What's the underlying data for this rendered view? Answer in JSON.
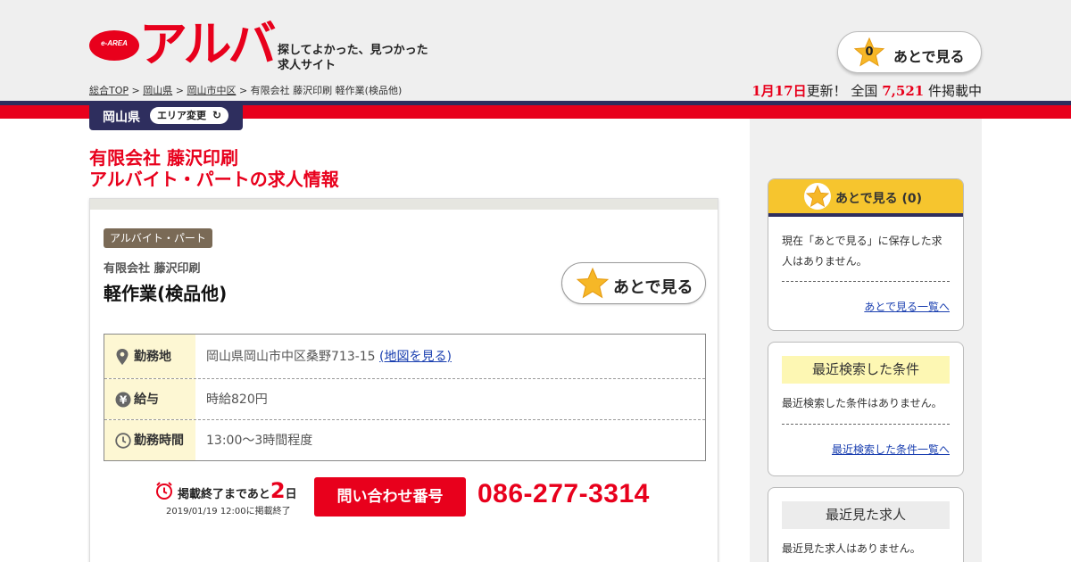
{
  "brand": {
    "logo_badge": "e-AREA",
    "logo_text": "アルバ",
    "tagline_line1": "探してよかった、見つかった",
    "tagline_line2": "求人サイト",
    "primary_color": "#e8001c",
    "navy_color": "#2e2e5e"
  },
  "breadcrumb": {
    "items": [
      "総合TOP",
      "岡山県",
      "岡山市中区"
    ],
    "separator": ">",
    "current": "有限会社 藤沢印刷 軽作業(検品他)"
  },
  "header": {
    "later_label": "あとで見る",
    "later_count": "0",
    "update_date": "1月17日",
    "update_suffix": "更新！",
    "nationwide_label": "全国",
    "total_count": "7,521",
    "count_suffix": "件掲載中"
  },
  "region": {
    "prefecture": "岡山県",
    "change_label": "エリア変更",
    "refresh_icon": "refresh-icon"
  },
  "page": {
    "title_line1": "有限会社 藤沢印刷",
    "title_line2": "アルバイト・パートの求人情報"
  },
  "job": {
    "type_badge": "アルバイト・パート",
    "company": "有限会社 藤沢印刷",
    "title": "軽作業(検品他)",
    "later_label": "あとで見る",
    "details": {
      "location_label": "勤務地",
      "location_value": "岡山県岡山市中区桑野713-15",
      "map_link": "(地図を見る)",
      "salary_label": "給与",
      "salary_value": "時給820円",
      "hours_label": "勤務時間",
      "hours_value": "13:00〜3時間程度"
    },
    "deadline": {
      "prefix": "掲載終了まであと",
      "days": "2",
      "unit": "日",
      "end_date": "2019/01/19 12:00に掲載終了"
    },
    "inquiry_label": "問い合わせ番号",
    "phone": "086-277-3314"
  },
  "sidebar": {
    "later": {
      "title": "あとで見る (0)",
      "empty_text": "現在「あとで見る」に保存した求人はありません。",
      "link": "あとで見る一覧へ"
    },
    "recent_search": {
      "title": "最近検索した条件",
      "empty_text": "最近検索した条件はありません。",
      "link": "最近検索した条件一覧へ"
    },
    "recent_viewed": {
      "title": "最近見た求人",
      "empty_text": "最近見た求人はありません。"
    }
  }
}
